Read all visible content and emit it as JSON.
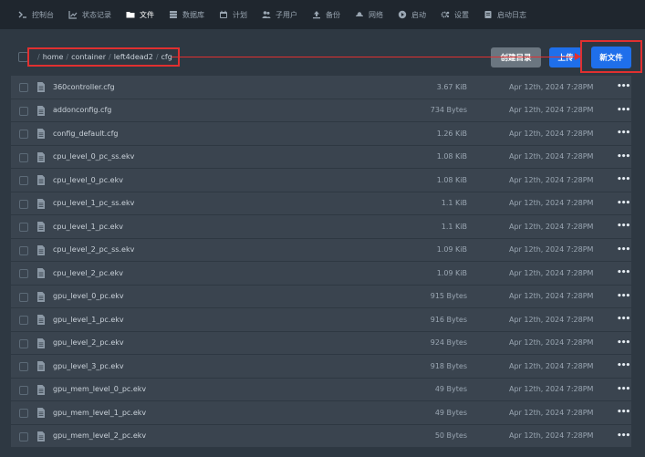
{
  "nav": {
    "items": [
      {
        "icon": "terminal-icon",
        "label": "控制台"
      },
      {
        "icon": "chart-icon",
        "label": "状态记录"
      },
      {
        "icon": "folder-icon",
        "label": "文件",
        "active": true
      },
      {
        "icon": "database-icon",
        "label": "数据库"
      },
      {
        "icon": "calendar-icon",
        "label": "计划"
      },
      {
        "icon": "users-icon",
        "label": "子用户"
      },
      {
        "icon": "upload-icon",
        "label": "备份"
      },
      {
        "icon": "network-icon",
        "label": "网络"
      },
      {
        "icon": "play-icon",
        "label": "启动"
      },
      {
        "icon": "gear-icon",
        "label": "设置"
      },
      {
        "icon": "log-icon",
        "label": "启动日志"
      }
    ]
  },
  "breadcrumb": {
    "root": "/",
    "segments": [
      "home",
      "container",
      "left4dead2",
      "cfg"
    ],
    "separator": "/"
  },
  "toolbar": {
    "create_dir_label": "创建目录",
    "upload_label": "上传",
    "new_file_label": "新文件"
  },
  "files": [
    {
      "name": "360controller.cfg",
      "size": "3.67 KiB",
      "date": "Apr 12th, 2024 7:28PM"
    },
    {
      "name": "addonconfig.cfg",
      "size": "734 Bytes",
      "date": "Apr 12th, 2024 7:28PM"
    },
    {
      "name": "config_default.cfg",
      "size": "1.26 KiB",
      "date": "Apr 12th, 2024 7:28PM"
    },
    {
      "name": "cpu_level_0_pc_ss.ekv",
      "size": "1.08 KiB",
      "date": "Apr 12th, 2024 7:28PM"
    },
    {
      "name": "cpu_level_0_pc.ekv",
      "size": "1.08 KiB",
      "date": "Apr 12th, 2024 7:28PM"
    },
    {
      "name": "cpu_level_1_pc_ss.ekv",
      "size": "1.1 KiB",
      "date": "Apr 12th, 2024 7:28PM"
    },
    {
      "name": "cpu_level_1_pc.ekv",
      "size": "1.1 KiB",
      "date": "Apr 12th, 2024 7:28PM"
    },
    {
      "name": "cpu_level_2_pc_ss.ekv",
      "size": "1.09 KiB",
      "date": "Apr 12th, 2024 7:28PM"
    },
    {
      "name": "cpu_level_2_pc.ekv",
      "size": "1.09 KiB",
      "date": "Apr 12th, 2024 7:28PM"
    },
    {
      "name": "gpu_level_0_pc.ekv",
      "size": "915 Bytes",
      "date": "Apr 12th, 2024 7:28PM"
    },
    {
      "name": "gpu_level_1_pc.ekv",
      "size": "916 Bytes",
      "date": "Apr 12th, 2024 7:28PM"
    },
    {
      "name": "gpu_level_2_pc.ekv",
      "size": "924 Bytes",
      "date": "Apr 12th, 2024 7:28PM"
    },
    {
      "name": "gpu_level_3_pc.ekv",
      "size": "918 Bytes",
      "date": "Apr 12th, 2024 7:28PM"
    },
    {
      "name": "gpu_mem_level_0_pc.ekv",
      "size": "49 Bytes",
      "date": "Apr 12th, 2024 7:28PM"
    },
    {
      "name": "gpu_mem_level_1_pc.ekv",
      "size": "49 Bytes",
      "date": "Apr 12th, 2024 7:28PM"
    },
    {
      "name": "gpu_mem_level_2_pc.ekv",
      "size": "50 Bytes",
      "date": "Apr 12th, 2024 7:28PM"
    }
  ],
  "row_menu_glyph": "•••",
  "colors": {
    "accent": "#1f6feb",
    "annotation": "#e03030",
    "background": "#2e3842",
    "row": "#3a444f",
    "nav": "#1f262e"
  }
}
